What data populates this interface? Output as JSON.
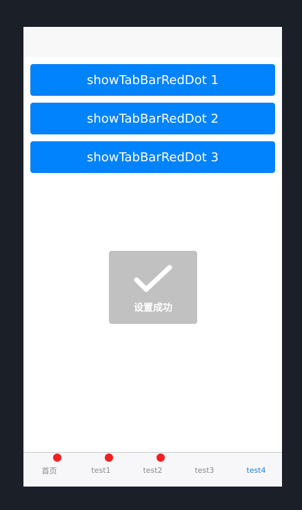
{
  "buttons": [
    {
      "label": "showTabBarRedDot 1"
    },
    {
      "label": "showTabBarRedDot 2"
    },
    {
      "label": "showTabBarRedDot 3"
    }
  ],
  "toast": {
    "icon": "checkmark-icon",
    "text": "设置成功"
  },
  "tabbar": {
    "items": [
      {
        "label": "首页",
        "red_dot": true,
        "active": false
      },
      {
        "label": "test1",
        "red_dot": true,
        "active": false
      },
      {
        "label": "test2",
        "red_dot": true,
        "active": false
      },
      {
        "label": "test3",
        "red_dot": false,
        "active": false
      },
      {
        "label": "test4",
        "red_dot": false,
        "active": true
      }
    ]
  },
  "colors": {
    "button": "#0083fd",
    "red_dot": "#f41f1f",
    "active_tab": "#1a7fd8",
    "inactive_tab": "#8a8a8a"
  }
}
